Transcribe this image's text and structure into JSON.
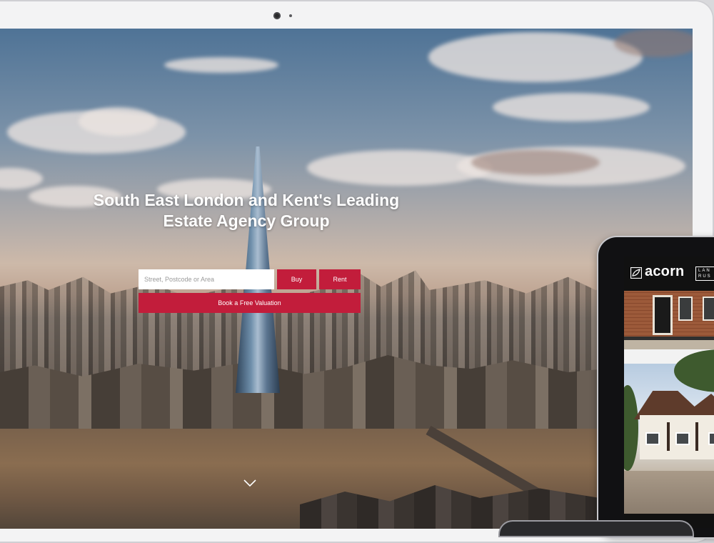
{
  "hero": {
    "title": "South East London and Kent's Leading Estate Agency Group"
  },
  "search": {
    "placeholder": "Street, Postcode or Area",
    "value": ""
  },
  "buttons": {
    "buy": "Buy",
    "rent": "Rent",
    "valuation": "Book a Free Valuation"
  },
  "tablet": {
    "brand": "acorn",
    "second_logo_line1": "LAN",
    "second_logo_line2": "RUS"
  },
  "colors": {
    "accent": "#c21d3b",
    "header": "#111111",
    "text_on_accent": "#ffffff"
  },
  "icons": {
    "scroll": "chevron-down-icon",
    "logo": "acorn-logo-icon"
  }
}
